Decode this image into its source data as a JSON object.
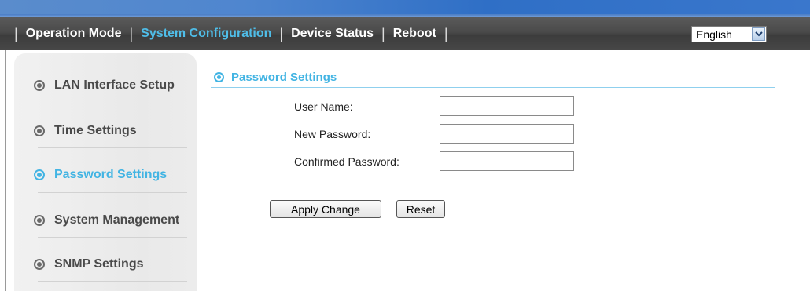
{
  "nav": {
    "items": [
      {
        "label": "Operation Mode"
      },
      {
        "label": "System Configuration"
      },
      {
        "label": "Device Status"
      },
      {
        "label": "Reboot"
      }
    ],
    "separator": "|",
    "language": {
      "selected": "English"
    }
  },
  "sidebar": {
    "items": [
      {
        "label": "LAN Interface Setup"
      },
      {
        "label": "Time Settings"
      },
      {
        "label": "Password Settings"
      },
      {
        "label": "System Management"
      },
      {
        "label": "SNMP Settings"
      }
    ]
  },
  "section": {
    "title": "Password Settings"
  },
  "form": {
    "user_name_label": "User Name:",
    "new_password_label": "New Password:",
    "confirmed_password_label": "Confirmed Password:",
    "user_name_value": "",
    "new_password_value": "",
    "confirmed_password_value": ""
  },
  "buttons": {
    "apply": "Apply Change",
    "reset": "Reset"
  },
  "colors": {
    "accent": "#42b4e3",
    "navbar": "#474747",
    "top_strip": "#3a77cc"
  }
}
